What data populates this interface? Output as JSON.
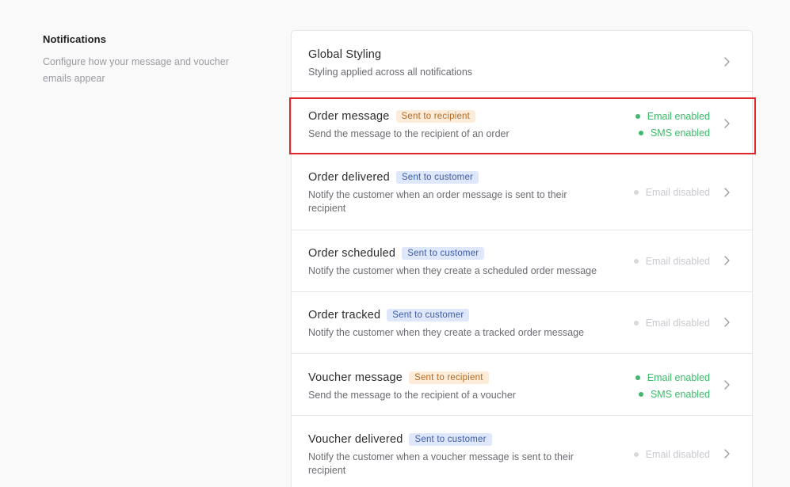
{
  "intro": {
    "title": "Notifications",
    "description": "Configure how your message and voucher emails appear"
  },
  "colors": {
    "recipient_badge_bg": "#fdecd9",
    "customer_badge_bg": "#dfe8fb",
    "enabled": "#3fb96b",
    "disabled": "#c9c9cf",
    "highlight": "#e0252b"
  },
  "rows": [
    {
      "title": "Global Styling",
      "badge": "",
      "description": "Styling applied across all notifications",
      "email_status": "",
      "sms_status": ""
    },
    {
      "title": "Order message",
      "badge": "Sent to recipient",
      "description": "Send the message to the recipient of an order",
      "email_status": "Email enabled",
      "sms_status": "SMS enabled"
    },
    {
      "title": "Order delivered",
      "badge": "Sent to customer",
      "description": "Notify the customer when an order message is sent to their recipient",
      "email_status": "Email disabled",
      "sms_status": ""
    },
    {
      "title": "Order scheduled",
      "badge": "Sent to customer",
      "description": "Notify the customer when they create a scheduled order message",
      "email_status": "Email disabled",
      "sms_status": ""
    },
    {
      "title": "Order tracked",
      "badge": "Sent to customer",
      "description": "Notify the customer when they create a tracked order message",
      "email_status": "Email disabled",
      "sms_status": ""
    },
    {
      "title": "Voucher message",
      "badge": "Sent to recipient",
      "description": "Send the message to the recipient of a voucher",
      "email_status": "Email enabled",
      "sms_status": "SMS enabled"
    },
    {
      "title": "Voucher delivered",
      "badge": "Sent to customer",
      "description": "Notify the customer when a voucher message is sent to their recipient",
      "email_status": "Email disabled",
      "sms_status": ""
    }
  ]
}
